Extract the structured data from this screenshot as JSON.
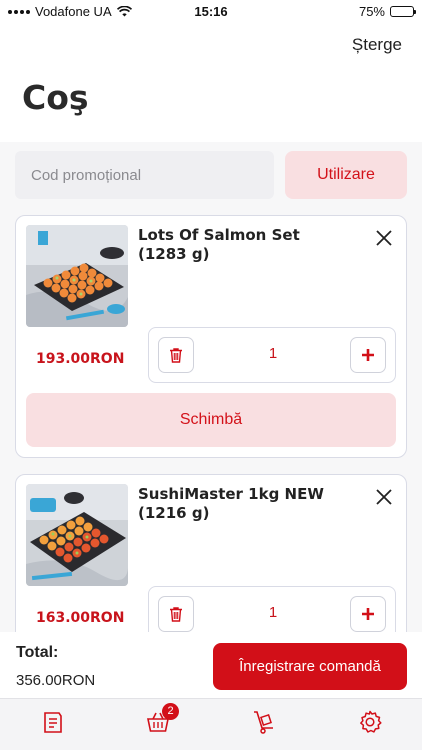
{
  "status_bar": {
    "carrier": "Vodafone UA",
    "time": "15:16",
    "battery": "75%"
  },
  "header": {
    "clear_label": "Șterge",
    "title": "Coş"
  },
  "promo": {
    "placeholder": "Cod promoțional",
    "apply_label": "Utilizare"
  },
  "cart": {
    "items": [
      {
        "name": "Lots Of Salmon Set (1283 g)",
        "price": "193.00RON",
        "quantity": "1",
        "change_label": "Schimbă"
      },
      {
        "name": "SushiMaster 1kg NEW (1216 g)",
        "price": "163.00RON",
        "quantity": "1"
      }
    ]
  },
  "footer": {
    "total_label": "Total:",
    "total_value": "356.00RON",
    "checkout_label": "Înregistrare comandă"
  },
  "tabbar": {
    "cart_badge": "2"
  },
  "colors": {
    "accent": "#d20f18",
    "accent_light": "#f9dfe1",
    "border": "#d9dbe6"
  }
}
